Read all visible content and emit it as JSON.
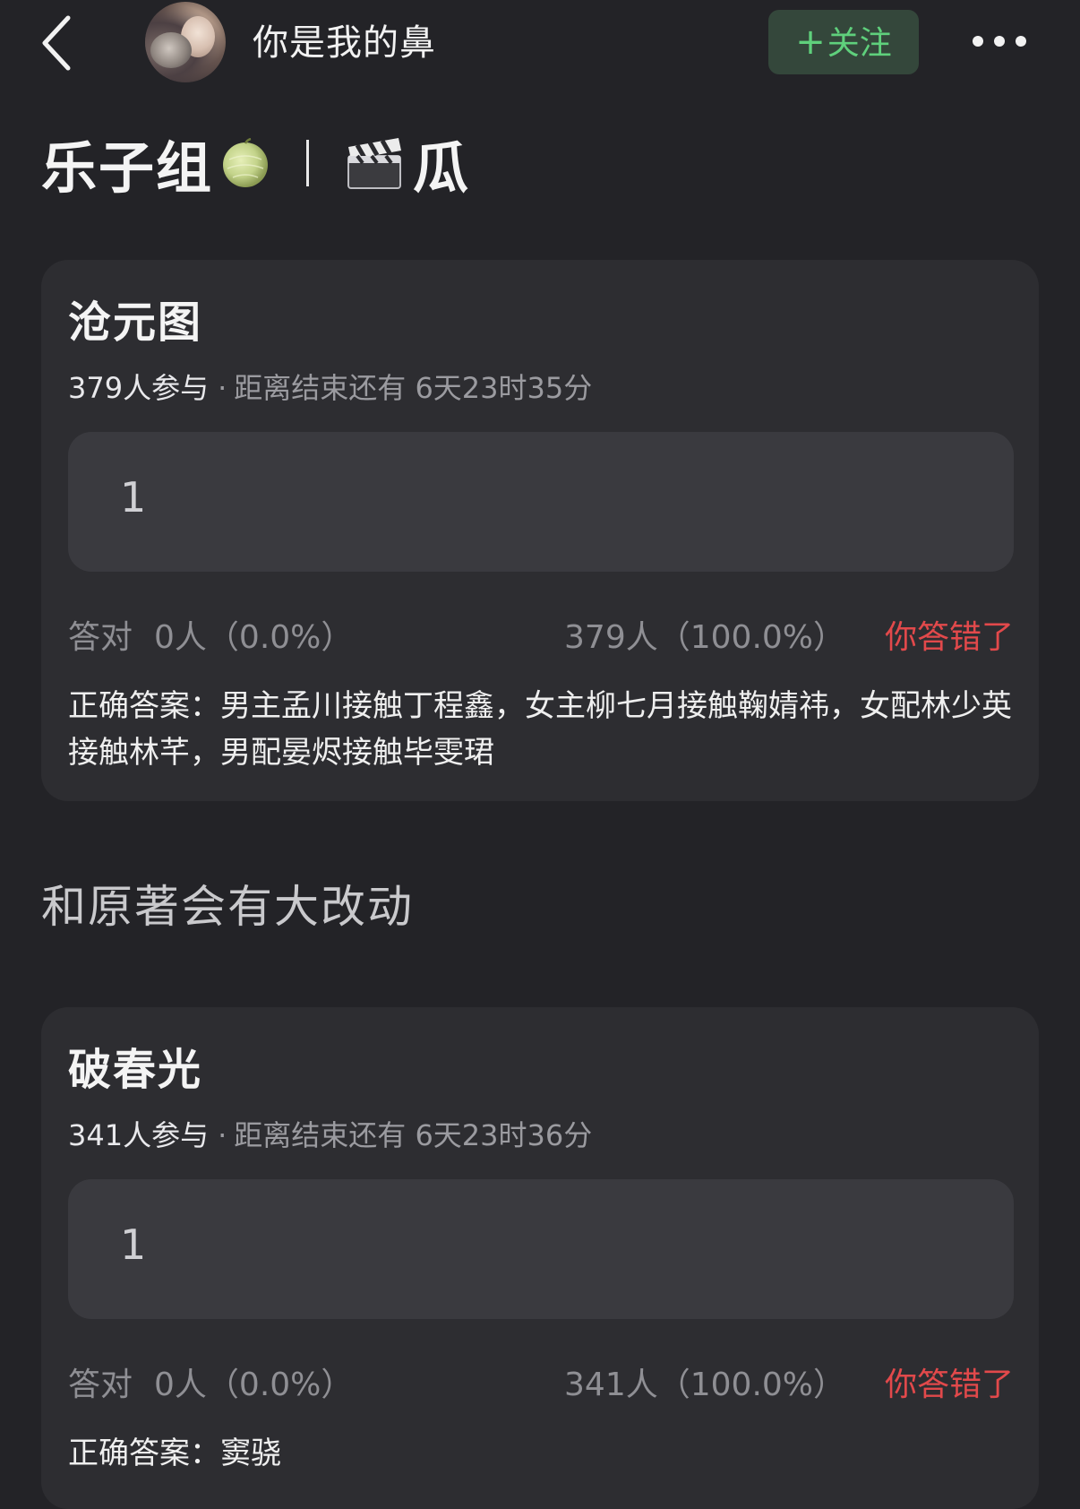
{
  "header": {
    "back_icon": "chevron-left-icon",
    "username": "你是我的鼻",
    "follow_label": "关注",
    "follow_plus": "+",
    "more_icon": "more-horizontal-icon"
  },
  "group": {
    "name": "乐子组",
    "melon_icon": "melon-icon",
    "clapper_icon": "clapper-board-icon",
    "topic": "瓜"
  },
  "quizzes": [
    {
      "title": "沧元图",
      "participants": "379人参与",
      "separator": "·",
      "time_left": "距离结束还有 6天23时35分",
      "answer_value": "1",
      "correct_label": "答对",
      "correct_stat": "0人（0.0%）",
      "wrong_stat": "379人（100.0%）",
      "result": "你答错了",
      "correct_answer": "正确答案：男主孟川接触丁程鑫，女主柳七月接触鞠婧祎，女配林少英接触林芊，男配晏烬接触毕雯珺"
    },
    {
      "title": "破春光",
      "participants": "341人参与",
      "separator": "·",
      "time_left": "距离结束还有 6天23时36分",
      "answer_value": "1",
      "correct_label": "答对",
      "correct_stat": "0人（0.0%）",
      "wrong_stat": "341人（100.0%）",
      "result": "你答错了",
      "correct_answer": "正确答案：窦骁"
    }
  ],
  "section_text": "和原著会有大改动",
  "colors": {
    "background": "#232327",
    "card": "#2d2d31",
    "follow_green": "#5fd07c",
    "wrong_red": "#e2494b"
  }
}
